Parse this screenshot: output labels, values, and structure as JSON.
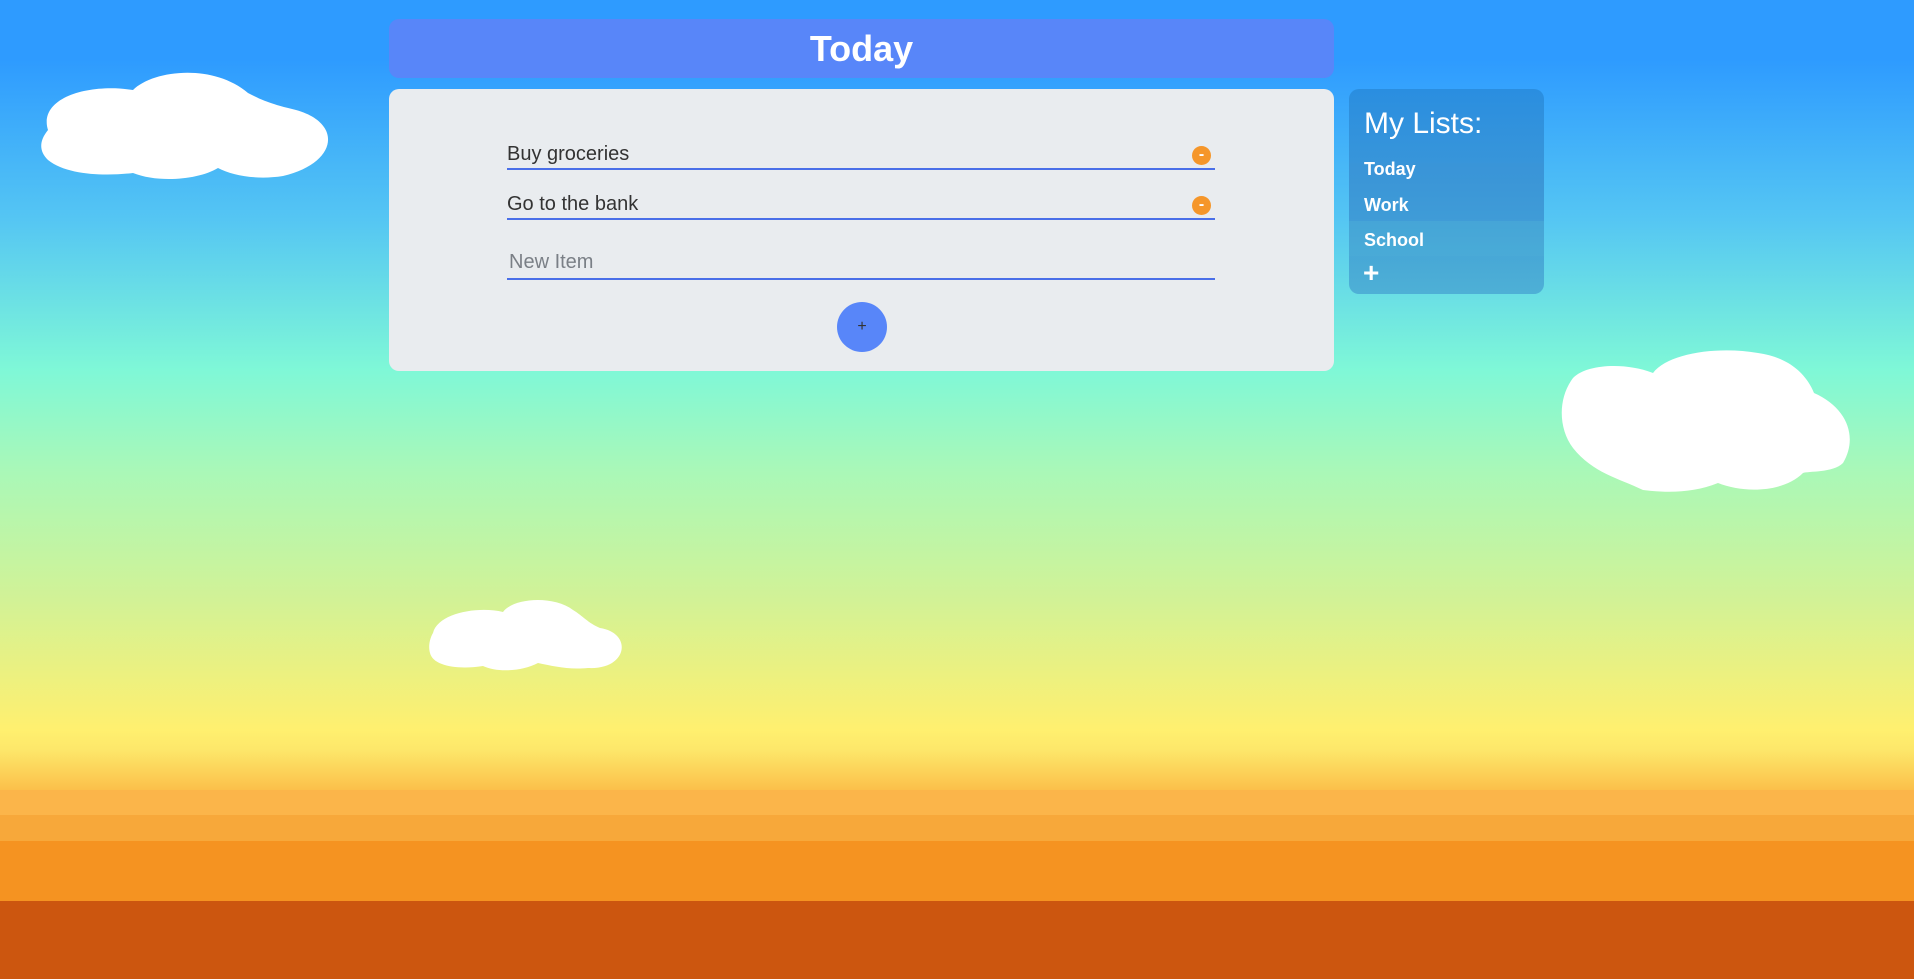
{
  "header": {
    "title": "Today"
  },
  "list": {
    "items": [
      {
        "label": "Buy groceries",
        "remove_label": "-"
      },
      {
        "label": "Go to the bank",
        "remove_label": "-"
      }
    ],
    "new_item_placeholder": "New Item",
    "add_button_label": "+"
  },
  "sidebar": {
    "title": "My Lists:",
    "lists": [
      "Today",
      "Work",
      "School"
    ],
    "add_list_label": "+"
  },
  "colors": {
    "header_bg": "#5886f9",
    "card_bg": "#e9ecef",
    "remove_button": "#f5962a",
    "underline": "#4a6fe8",
    "sidebar_bg": "#2a8ee0"
  },
  "icons": {
    "remove": "minus-circle-icon",
    "add_item": "plus-icon",
    "add_list": "plus-icon"
  }
}
